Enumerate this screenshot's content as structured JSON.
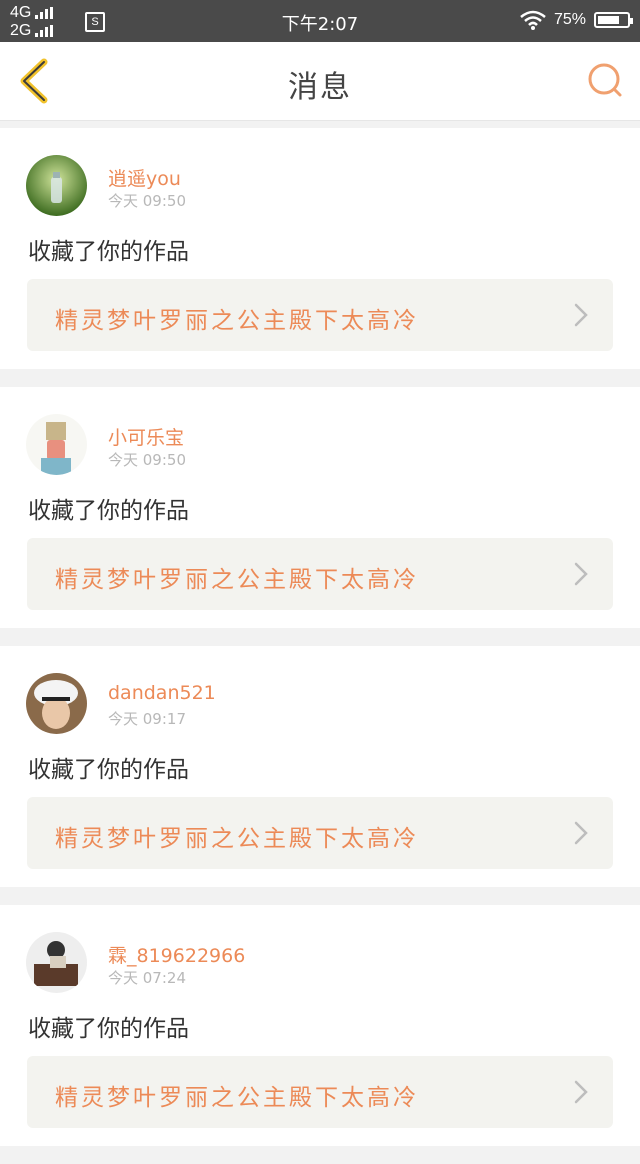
{
  "status_bar": {
    "network1": "4G",
    "network2": "2G",
    "sim_badge": "S",
    "time": "下午2:07",
    "battery_percent": "75%",
    "battery_level": 0.75,
    "icons": [
      "signal-icon",
      "wifi-icon",
      "battery-icon"
    ]
  },
  "header": {
    "title": "消息",
    "back_icon": "chevron-left-icon",
    "search_icon": "search-icon",
    "accent_color": "#ec8a57"
  },
  "messages": [
    {
      "user": "逍遥you",
      "time": "今天 09:50",
      "action": "收藏了你的作品",
      "work_title": "精灵梦叶罗丽之公主殿下太高冷"
    },
    {
      "user": "小可乐宝",
      "time": "今天 09:50",
      "action": "收藏了你的作品",
      "work_title": "精灵梦叶罗丽之公主殿下太高冷"
    },
    {
      "user": "dandan521",
      "time": "今天 09:17",
      "action": "收藏了你的作品",
      "work_title": "精灵梦叶罗丽之公主殿下太高冷"
    },
    {
      "user": "霖_819622966",
      "time": "今天 07:24",
      "action": "收藏了你的作品",
      "work_title": "精灵梦叶罗丽之公主殿下太高冷"
    }
  ]
}
